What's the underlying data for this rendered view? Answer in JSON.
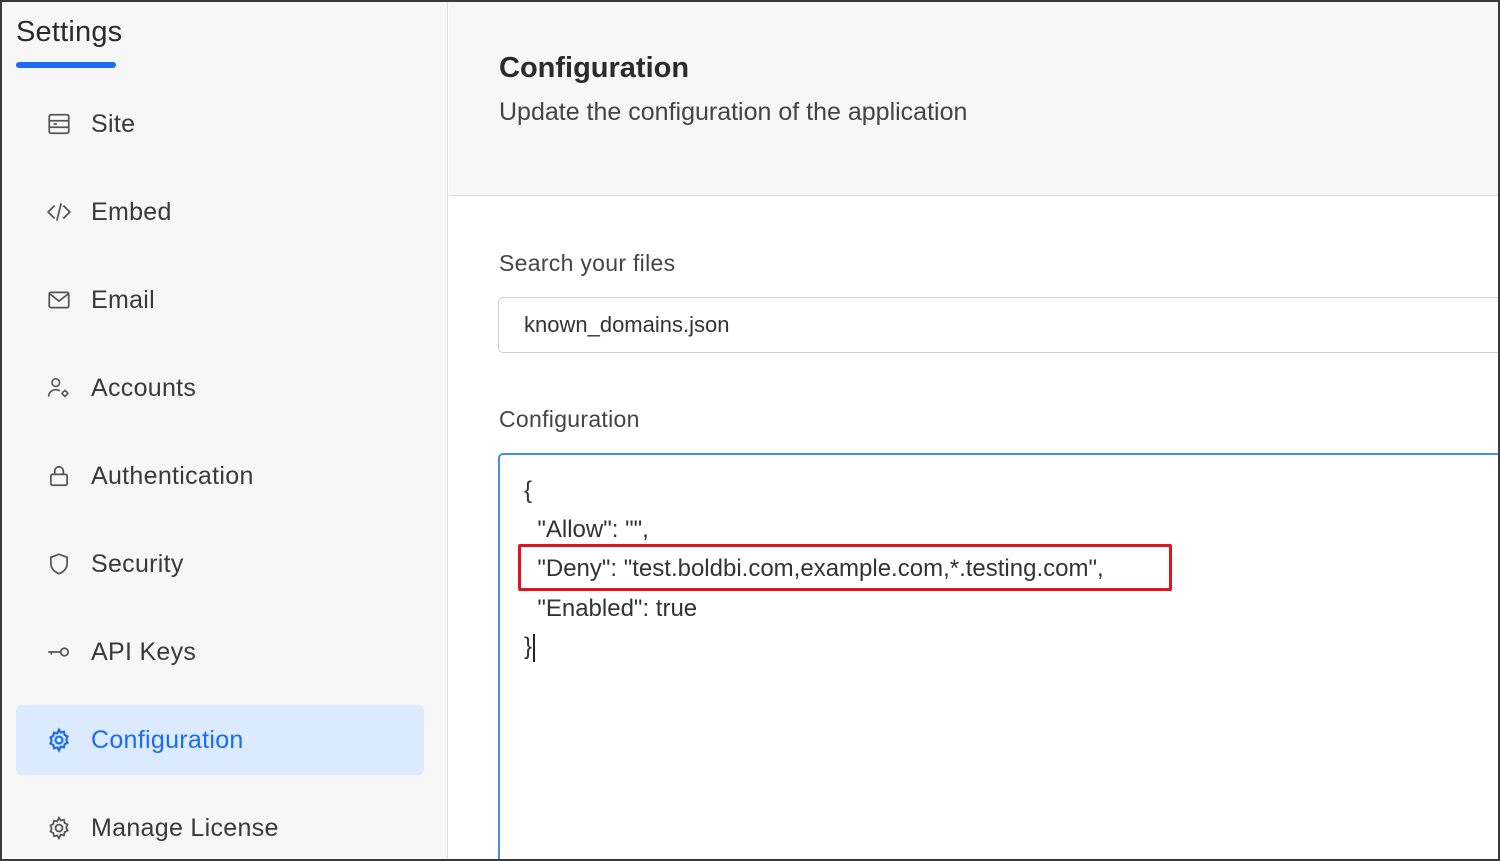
{
  "sidebar": {
    "title": "Settings",
    "items": [
      {
        "label": "Site",
        "icon": "site-icon"
      },
      {
        "label": "Embed",
        "icon": "code-icon"
      },
      {
        "label": "Email",
        "icon": "mail-icon"
      },
      {
        "label": "Accounts",
        "icon": "accounts-icon"
      },
      {
        "label": "Authentication",
        "icon": "lock-icon"
      },
      {
        "label": "Security",
        "icon": "shield-icon"
      },
      {
        "label": "API Keys",
        "icon": "key-icon"
      },
      {
        "label": "Configuration",
        "icon": "gear-icon",
        "active": true
      },
      {
        "label": "Manage License",
        "icon": "license-gear-icon"
      }
    ]
  },
  "header": {
    "title": "Configuration",
    "subtitle": "Update the configuration of the application"
  },
  "search": {
    "label": "Search your files",
    "value": "known_domains.json"
  },
  "config": {
    "label": "Configuration",
    "lines": [
      "{",
      "  \"Allow\": \"\",",
      "  \"Deny\": \"test.boldbi.com,example.com,*.testing.com\",",
      "  \"Enabled\": true",
      "}"
    ]
  },
  "colors": {
    "accent": "#1a6cf0",
    "active_bg": "#dceaff",
    "highlight": "#e0141e"
  }
}
